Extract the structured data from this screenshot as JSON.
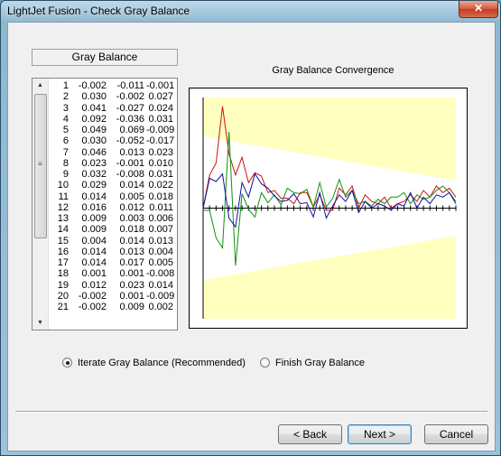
{
  "window": {
    "title": "LightJet Fusion - Check Gray Balance",
    "close_glyph": "✕"
  },
  "panel": {
    "header": "Gray Balance"
  },
  "table_rows": [
    [
      "1",
      "-0.002",
      "-0.011",
      "-0.001"
    ],
    [
      "2",
      "0.030",
      "-0.002",
      "0.027"
    ],
    [
      "3",
      "0.041",
      "-0.027",
      "0.024"
    ],
    [
      "4",
      "0.092",
      "-0.036",
      "0.031"
    ],
    [
      "5",
      "0.049",
      "0.069",
      "-0.009"
    ],
    [
      "6",
      "0.030",
      "-0.052",
      "-0.017"
    ],
    [
      "7",
      "0.046",
      "0.013",
      "0.023"
    ],
    [
      "8",
      "0.023",
      "-0.001",
      "0.010"
    ],
    [
      "9",
      "0.032",
      "-0.008",
      "0.031"
    ],
    [
      "10",
      "0.029",
      "0.014",
      "0.022"
    ],
    [
      "11",
      "0.014",
      "0.005",
      "0.018"
    ],
    [
      "12",
      "0.016",
      "0.012",
      "0.011"
    ],
    [
      "13",
      "0.009",
      "0.003",
      "0.006"
    ],
    [
      "14",
      "0.009",
      "0.018",
      "0.007"
    ],
    [
      "15",
      "0.004",
      "0.014",
      "0.013"
    ],
    [
      "16",
      "0.014",
      "0.013",
      "0.004"
    ],
    [
      "17",
      "0.014",
      "0.017",
      "0.005"
    ],
    [
      "18",
      "0.001",
      "0.001",
      "-0.008"
    ],
    [
      "19",
      "0.012",
      "0.023",
      "0.014"
    ],
    [
      "20",
      "-0.002",
      "0.001",
      "-0.009"
    ],
    [
      "21",
      "-0.002",
      "0.009",
      "0.002"
    ]
  ],
  "chart_data": {
    "type": "line",
    "title": "Gray Balance Convergence",
    "x": [
      1,
      2,
      3,
      4,
      5,
      6,
      7,
      8,
      9,
      10,
      11,
      12,
      13,
      14,
      15,
      16,
      17,
      18,
      19,
      20,
      21,
      22,
      23,
      24,
      25,
      26,
      27,
      28,
      29,
      30,
      31,
      32,
      33,
      34,
      35,
      36,
      37,
      38,
      39,
      40
    ],
    "ylim": [
      -0.1,
      0.1
    ],
    "series": [
      {
        "color": "#d01010",
        "values": [
          0.0,
          0.03,
          0.041,
          0.092,
          0.049,
          0.03,
          0.046,
          0.023,
          0.032,
          0.029,
          0.014,
          0.016,
          0.009,
          0.009,
          0.004,
          0.014,
          0.014,
          0.001,
          0.012,
          -0.002,
          -0.002,
          0.018,
          0.012,
          0.02,
          0.0,
          0.012,
          0.006,
          0.004,
          0.01,
          0.0,
          0.004,
          0.006,
          0.012,
          0.006,
          0.016,
          0.01,
          0.02,
          0.014,
          0.018,
          0.01
        ]
      },
      {
        "color": "#109010",
        "values": [
          -0.002,
          -0.002,
          -0.027,
          -0.036,
          0.069,
          -0.052,
          0.013,
          -0.001,
          -0.008,
          0.014,
          0.005,
          0.012,
          0.003,
          0.018,
          0.014,
          0.013,
          0.017,
          0.001,
          0.023,
          0.001,
          0.009,
          0.026,
          0.01,
          0.016,
          0.004,
          0.006,
          0.002,
          0.008,
          0.004,
          0.01,
          0.01,
          0.014,
          0.004,
          0.012,
          0.008,
          0.01,
          0.016,
          0.02,
          0.014,
          0.006
        ]
      },
      {
        "color": "#1010a0",
        "values": [
          0.0,
          0.027,
          0.024,
          0.031,
          -0.009,
          -0.017,
          0.023,
          0.01,
          0.031,
          0.022,
          0.018,
          0.011,
          0.006,
          0.007,
          0.013,
          0.004,
          0.005,
          -0.008,
          0.014,
          -0.009,
          0.002,
          0.012,
          0.006,
          0.016,
          -0.004,
          0.006,
          0.0,
          0.004,
          0.002,
          -0.002,
          0.004,
          0.002,
          0.014,
          0.0,
          0.01,
          0.004,
          0.012,
          0.01,
          0.014,
          0.004
        ]
      }
    ]
  },
  "options": {
    "iterate_label": "Iterate Gray Balance (Recommended)",
    "finish_label": "Finish Gray Balance",
    "selected": "iterate"
  },
  "buttons": {
    "back": "< Back",
    "next": "Next >",
    "cancel": "Cancel"
  }
}
